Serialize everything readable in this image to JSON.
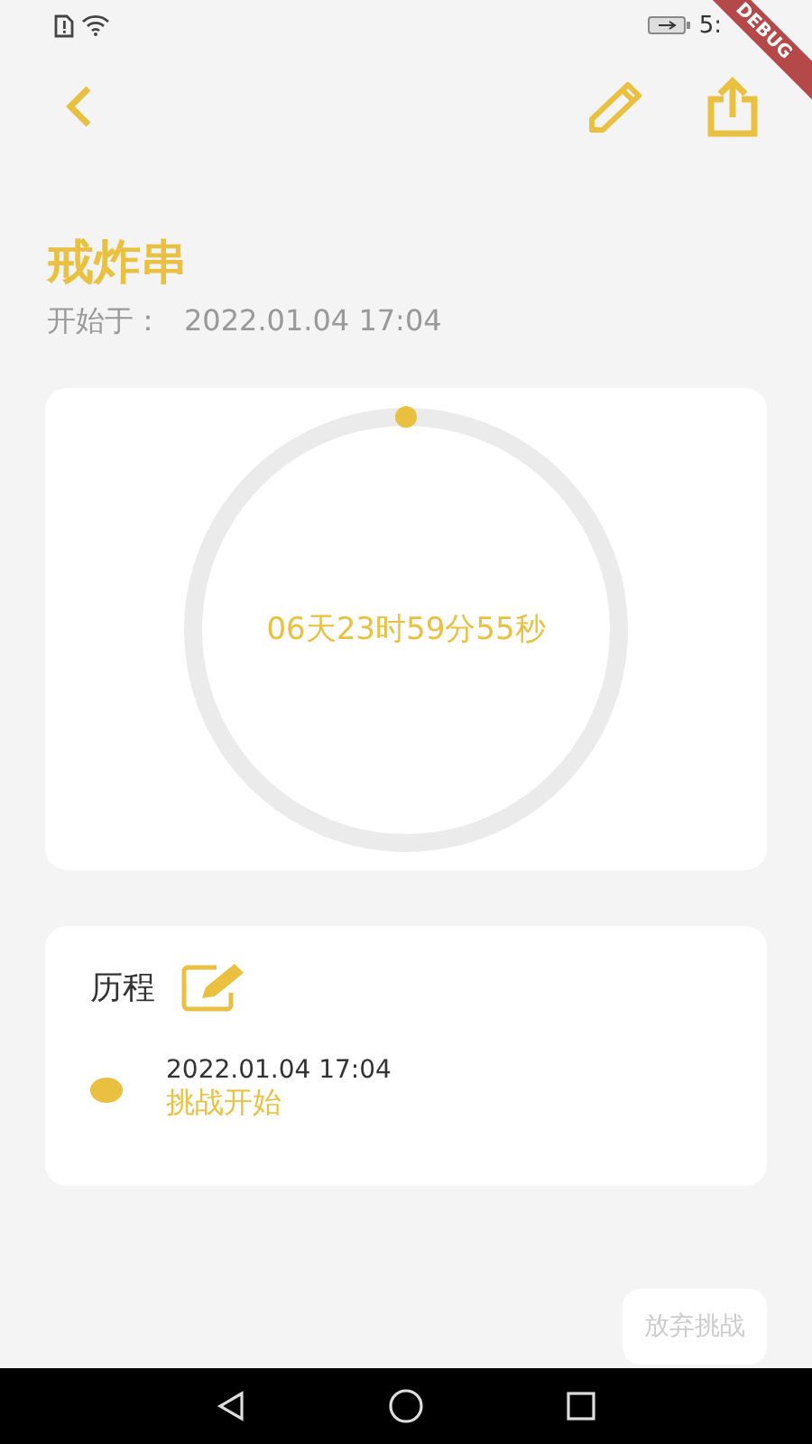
{
  "status_bar": {
    "time": "5:"
  },
  "debug_banner": {
    "label": "DEBUG"
  },
  "title": "戒炸串",
  "start": {
    "label": "开始于：",
    "value": "2022.01.04 17:04"
  },
  "progress": {
    "countdown": "06天23时59分55秒"
  },
  "history": {
    "title": "历程",
    "entries": [
      {
        "time": "2022.01.04 17:04",
        "label": "挑战开始"
      }
    ]
  },
  "abandon_button": "放弃挑战"
}
